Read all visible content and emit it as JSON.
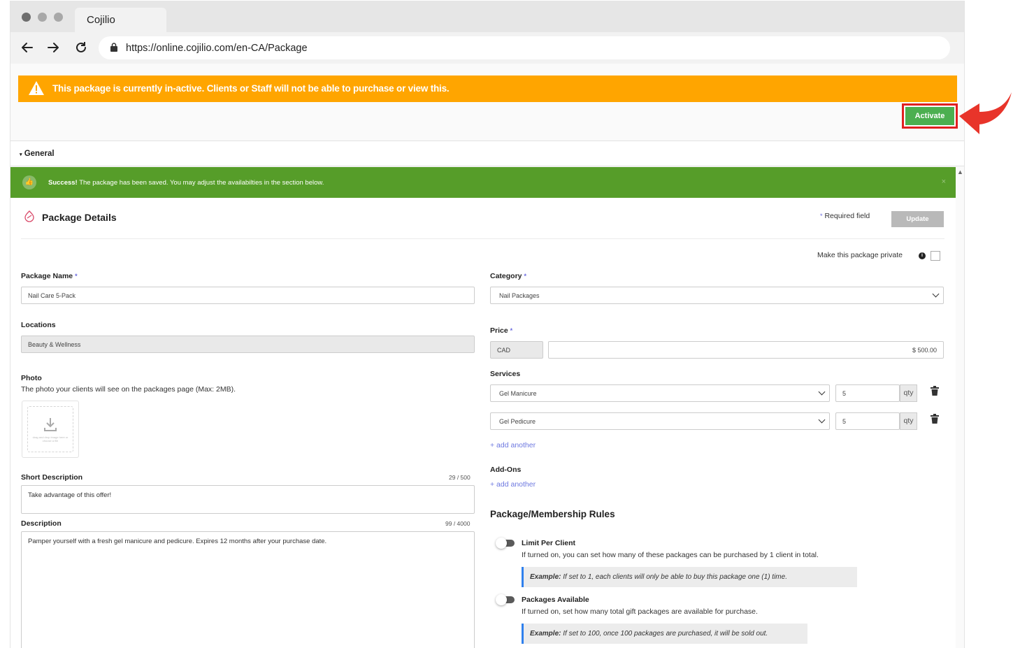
{
  "browser": {
    "tab_title": "Cojilio",
    "url": "https://online.cojilio.com/en-CA/Package"
  },
  "banner": {
    "text": "This package is currently in-active. Clients or Staff will not be able to purchase or view this."
  },
  "activate_label": "Activate",
  "general_label": "General",
  "success": {
    "strong": "Success!",
    "text": " The package has been saved. You may adjust the availabilties in the section below.",
    "close": "×"
  },
  "package_details": {
    "title": "Package Details",
    "required_note": "Required field",
    "required_mark": "*",
    "update_label": "Update",
    "private_label": "Make this package private",
    "info_glyph": "i"
  },
  "form": {
    "package_name_label": "Package Name",
    "package_name_value": "Nail Care 5-Pack",
    "locations_label": "Locations",
    "locations_value": "Beauty & Wellness",
    "photo_label": "Photo",
    "photo_help": "The photo your clients will see on the packages page (Max: 2MB).",
    "photo_drop_text": "drag and drop image here or choose a file",
    "short_desc_label": "Short Description",
    "short_desc_counter": "29 / 500",
    "short_desc_value": "Take advantage of this offer!",
    "desc_label": "Description",
    "desc_counter": "99 / 4000",
    "desc_value": "Pamper yourself with a fresh gel manicure and pedicure. Expires 12 months after your purchase date.",
    "category_label": "Category",
    "category_value": "Nail Packages",
    "price_label": "Price",
    "price_currency": "CAD",
    "price_value": "$ 500.00",
    "services_label": "Services",
    "services": [
      {
        "name": "Gel Manicure",
        "qty": "5",
        "qty_unit": "qty"
      },
      {
        "name": "Gel Pedicure",
        "qty": "5",
        "qty_unit": "qty"
      }
    ],
    "add_another": "+ add another",
    "addons_label": "Add-Ons"
  },
  "rules": {
    "title": "Package/Membership Rules",
    "items": [
      {
        "heading": "Limit Per Client",
        "description": "If turned on, you can set how many of these packages can be purchased by 1 client in total.",
        "example_bold": "Example:",
        "example_text": " If set to 1, each clients will only be able to buy this package one (1) time."
      },
      {
        "heading": "Packages Available",
        "description": "If turned on, set how many total gift packages are available for purchase.",
        "example_bold": "Example:",
        "example_text": " If set to 100, once 100 packages are purchased, it will be sold out."
      }
    ]
  },
  "colors": {
    "warning": "#ffa500",
    "success": "#569d29",
    "activate": "#4caf50",
    "highlight": "#e02020",
    "link": "#6d78e0"
  }
}
